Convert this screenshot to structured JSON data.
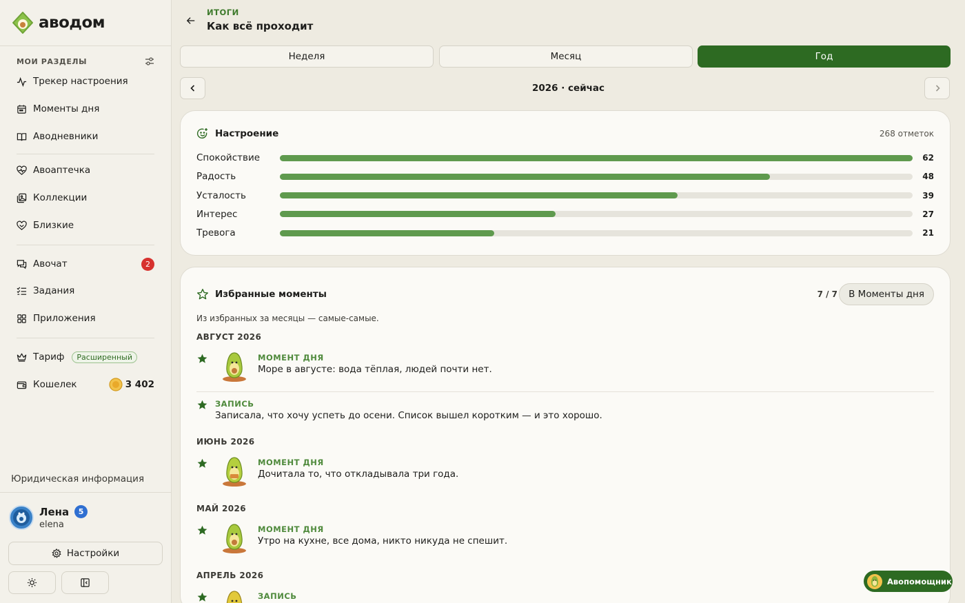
{
  "app": {
    "name": "авodom",
    "logo_text": "аводом"
  },
  "sidebar": {
    "section_title": "МОИ РАЗДЕЛЫ",
    "items": [
      {
        "label": "Трекер настроения",
        "icon": "activity-icon"
      },
      {
        "label": "Моменты дня",
        "icon": "calendar-icon"
      },
      {
        "label": "Аводневники",
        "icon": "book-icon"
      },
      {
        "label": "Авоаптечка",
        "icon": "heart-pulse-icon"
      },
      {
        "label": "Коллекции",
        "icon": "gallery-icon"
      },
      {
        "label": "Близкие",
        "icon": "heart-hands-icon"
      },
      {
        "label": "Авочат",
        "icon": "chat-icon",
        "badge": "2"
      },
      {
        "label": "Задания",
        "icon": "checklist-icon"
      },
      {
        "label": "Приложения",
        "icon": "grid-icon"
      },
      {
        "label": "Тариф",
        "icon": "crown-icon",
        "pill": "Расширенный"
      },
      {
        "label": "Кошелек",
        "icon": "wallet-icon",
        "amount": "3 402"
      }
    ],
    "legal": "Юридическая информация",
    "user": {
      "name": "Лена",
      "login": "elena",
      "badge": "5"
    },
    "settings_label": "Настройки"
  },
  "header": {
    "kicker": "ИТОГИ",
    "title": "Как всё проходит"
  },
  "period_tabs": [
    {
      "label": "Неделя",
      "active": false
    },
    {
      "label": "Месяц",
      "active": false
    },
    {
      "label": "Год",
      "active": true
    }
  ],
  "period": {
    "label": "2026 · сейчас"
  },
  "mood_card": {
    "title": "Настроение",
    "meta": "268 отметок",
    "max": 62,
    "rows": [
      {
        "label": "Спокойствие",
        "value": 62
      },
      {
        "label": "Радость",
        "value": 48
      },
      {
        "label": "Усталость",
        "value": 39
      },
      {
        "label": "Интерес",
        "value": 27
      },
      {
        "label": "Тревога",
        "value": 21
      }
    ]
  },
  "favorites": {
    "title": "Избранные моменты",
    "count": "7 / 7",
    "button": "В Моменты дня",
    "subtitle": "Из избранных за месяцы — самые-самые.",
    "months": [
      {
        "title": "АВГУСТ 2026"
      },
      {
        "title": "ИЮНЬ 2026"
      },
      {
        "title": "МАЙ 2026"
      },
      {
        "title": "АПРЕЛЬ 2026"
      }
    ],
    "items": [
      {
        "type": "МОМЕНТ ДНЯ",
        "text": "Море в августе: вода тёплая, людей почти нет."
      },
      {
        "type": "ЗАПИСЬ",
        "text": "Записала, что хочу успеть до осени. Список вышел коротким — и это хорошо."
      },
      {
        "type": "МОМЕНТ ДНЯ",
        "text": "Дочитала то, что откладывала три года."
      },
      {
        "type": "МОМЕНТ ДНЯ",
        "text": "Утро на кухне, все дома, никто никуда не спешит."
      },
      {
        "type": "ЗАПИСЬ",
        "text": ""
      }
    ]
  },
  "assistant": {
    "label": "Авопомощник"
  },
  "colors": {
    "accent": "#2d6a22",
    "bar": "#5f9a4e",
    "badge": "#d7322f"
  }
}
